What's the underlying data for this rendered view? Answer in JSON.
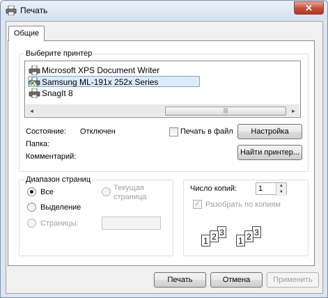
{
  "window": {
    "title": "Печать",
    "close_glyph": "✕"
  },
  "tabs": [
    {
      "label": "Общие"
    }
  ],
  "printer_group": {
    "label": "Выберите принтер",
    "printers": [
      {
        "name": "Microsoft XPS Document Writer",
        "icon": "printer-icon",
        "selected": false
      },
      {
        "name": "Samsung ML-191x 252x Series",
        "icon": "printer-default-icon",
        "selected": true
      },
      {
        "name": "SnagIt 8",
        "icon": "printer-icon",
        "selected": false
      }
    ],
    "scroll": {
      "left_arrow": "◄",
      "right_arrow": "►",
      "thumb_grip": "|||"
    }
  },
  "status": {
    "state_label": "Состояние:",
    "state_value": "Отключен",
    "folder_label": "Папка:",
    "folder_value": "",
    "comment_label": "Комментарий:",
    "comment_value": ""
  },
  "print_to_file": {
    "label": "Печать в файл",
    "checked": false
  },
  "buttons": {
    "preferences": "Настройка",
    "find_printer": "Найти принтер...",
    "print": "Печать",
    "cancel": "Отмена",
    "apply": "Применить"
  },
  "page_range": {
    "label": "Диапазон страниц",
    "all": "Все",
    "selection": "Выделение",
    "current_line1": "Текущая",
    "current_line2": "страница",
    "pages": "Страницы:",
    "pages_value": ""
  },
  "copies": {
    "label": "Число копий:",
    "value": "1",
    "collate_label": "Разобрать по копиям",
    "collate_checked": true,
    "spin_up": "▲",
    "spin_down": "▼"
  },
  "collate_illustration": {
    "pages": [
      "1",
      "2",
      "3"
    ]
  }
}
